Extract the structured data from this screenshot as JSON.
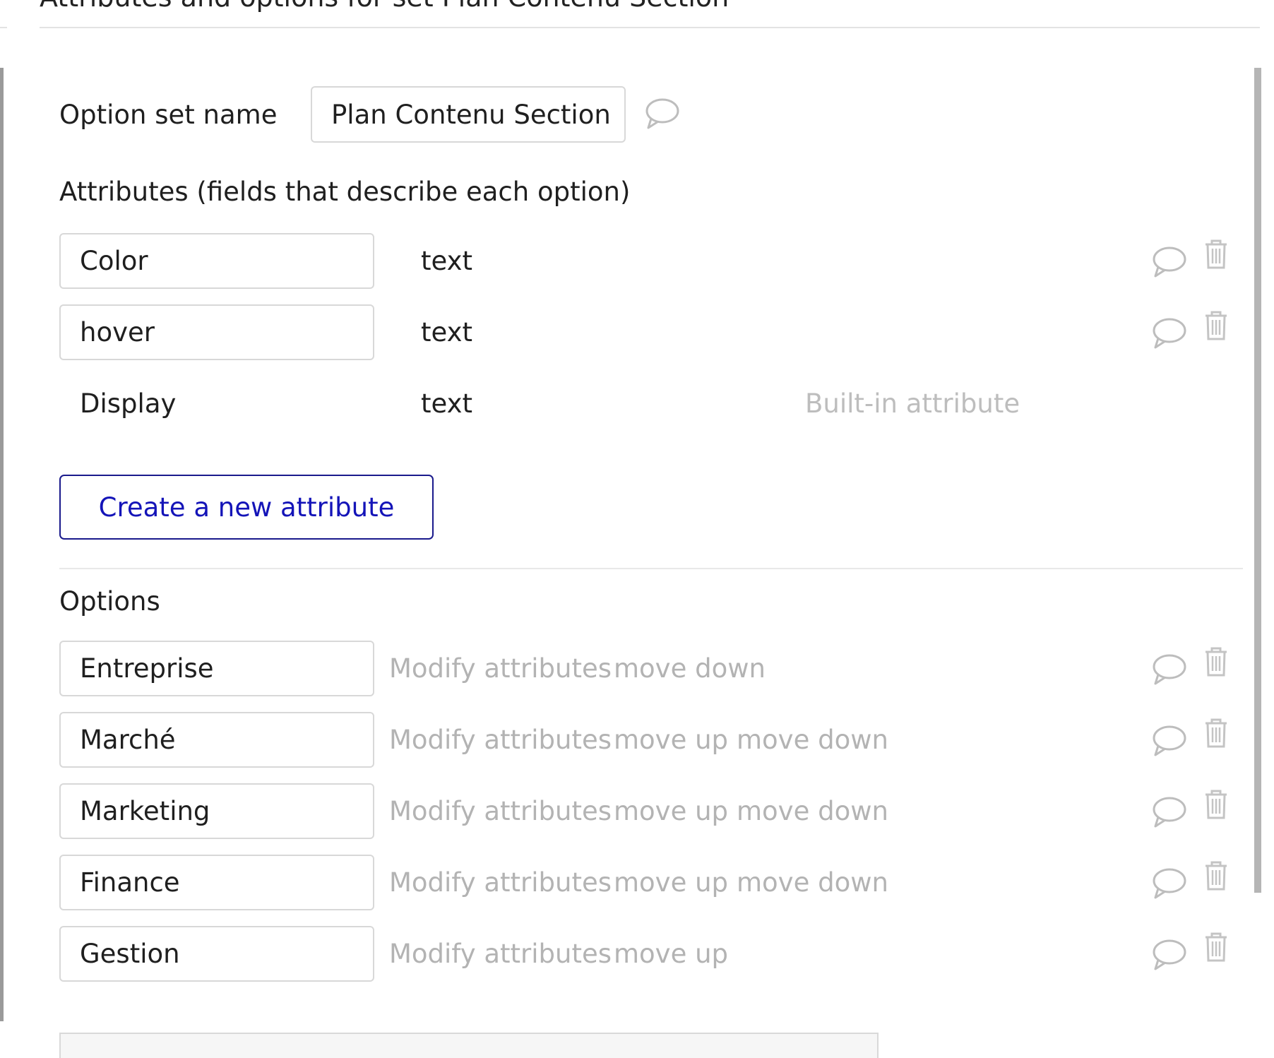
{
  "header": {
    "title": "Attributes and options for set Plan Contenu Section"
  },
  "option_set": {
    "label": "Option set name",
    "name_value": "Plan Contenu Section"
  },
  "attributes": {
    "heading": "Attributes (fields that describe each option)",
    "items": [
      {
        "name": "Color",
        "type": "text"
      },
      {
        "name": "hover",
        "type": "text"
      }
    ],
    "builtin": {
      "name": "Display",
      "type": "text",
      "note": "Built-in attribute"
    },
    "create_label": "Create a new attribute"
  },
  "options": {
    "heading": "Options",
    "modify_label": "Modify attributes",
    "move_up_label": "move up",
    "move_down_label": "move down",
    "items": [
      {
        "name": "Entreprise"
      },
      {
        "name": "Marché"
      },
      {
        "name": "Marketing"
      },
      {
        "name": "Finance"
      },
      {
        "name": "Gestion"
      }
    ]
  },
  "icons": {
    "comment": "speech-bubble-icon",
    "delete": "trash-icon"
  },
  "colors": {
    "accent": "#1414b8",
    "muted_text": "#b3b3b3",
    "border": "#d8d8d8"
  }
}
